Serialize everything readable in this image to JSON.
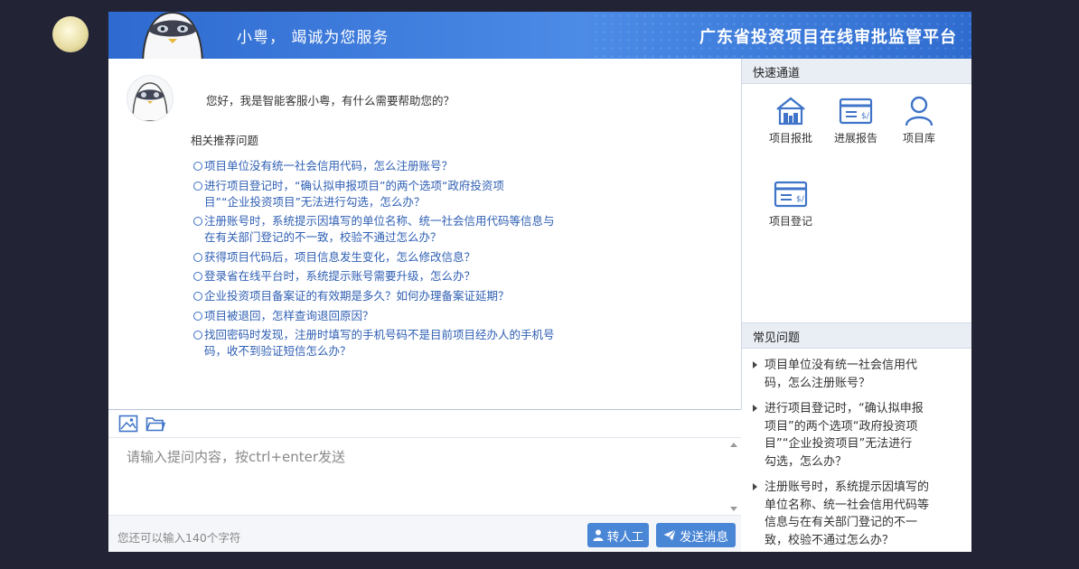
{
  "header": {
    "greeting": "小粤， 竭诚为您服务",
    "title": "广东省投资项目在线审批监管平台"
  },
  "chat": {
    "welcome": "您好，我是智能客服小粤，有什么需要帮助您的？",
    "recommend_title": "相关推荐问题",
    "questions": [
      {
        "lines": [
          "项目单位没有统一社会信用代码，怎么注册账号？"
        ]
      },
      {
        "lines": [
          "进行项目登记时，“确认拟申报项目”的两个选项“政府投资项",
          "目”“企业投资项目”无法进行勾选，怎么办？"
        ]
      },
      {
        "lines": [
          "注册账号时，系统提示因填写的单位名称、统一社会信用代码等信息与",
          "在有关部门登记的不一致，校验不通过怎么办？"
        ]
      },
      {
        "lines": [
          "获得项目代码后，项目信息发生变化，怎么修改信息？"
        ]
      },
      {
        "lines": [
          "登录省在线平台时，系统提示账号需要升级，怎么办？"
        ]
      },
      {
        "lines": [
          "企业投资项目备案证的有效期是多久？如何办理备案证延期？"
        ]
      },
      {
        "lines": [
          "项目被退回，怎样查询退回原因？"
        ]
      },
      {
        "lines": [
          "找回密码时发现，注册时填写的手机号码不是目前项目经办人的手机号",
          "码，收不到验证短信怎么办？"
        ]
      }
    ]
  },
  "toolbar": {
    "icons": [
      "image-icon",
      "folder-icon"
    ]
  },
  "input": {
    "placeholder": "请输入提问内容，按ctrl+enter发送",
    "value": ""
  },
  "footer": {
    "char_count": "您还可以输入140个字符",
    "transfer_label": "转人工",
    "send_label": "发送消息"
  },
  "sidebar": {
    "quick_title": "快速通道",
    "quick_items": [
      {
        "label": "项目报批",
        "icon": "building-icon"
      },
      {
        "label": "进展报告",
        "icon": "card-icon"
      },
      {
        "label": "项目库",
        "icon": "user-icon"
      },
      {
        "label": "项目登记",
        "icon": "card-icon"
      }
    ],
    "faq_title": "常见问题",
    "faq": [
      {
        "lines": [
          "项目单位没有统一社会信用代",
          "码，怎么注册账号？"
        ]
      },
      {
        "lines": [
          "进行项目登记时，“确认拟申报",
          "项目”的两个选项“政府投资项",
          "目”“企业投资项目”无法进行",
          "勾选，怎么办？"
        ]
      },
      {
        "lines": [
          "注册账号时，系统提示因填写的",
          "单位名称、统一社会信用代码等",
          "信息与在有关部门登记的不一",
          "致，校验不通过怎么办？"
        ]
      }
    ]
  },
  "colors": {
    "header_blue": "#3b78d8",
    "link_blue": "#2f5fb3",
    "button_blue": "#4a86d6"
  }
}
